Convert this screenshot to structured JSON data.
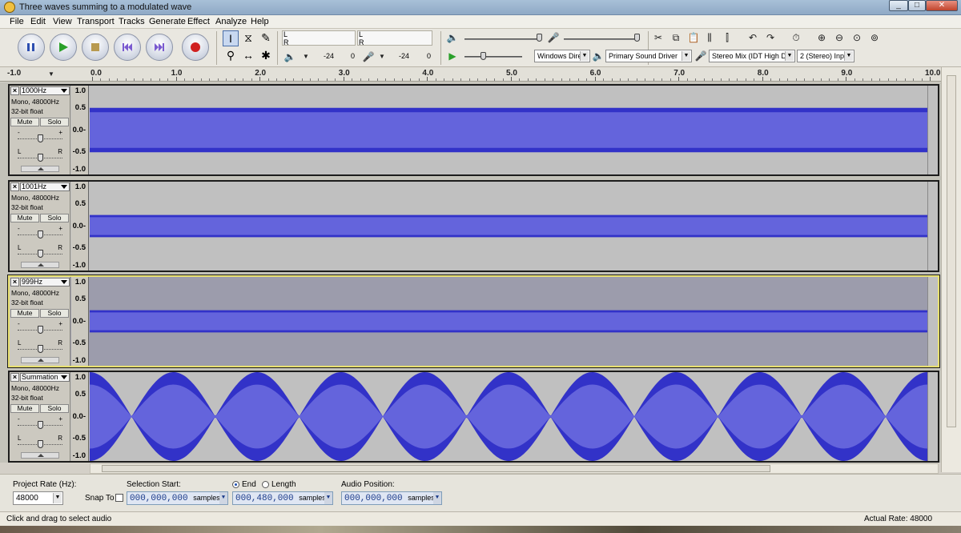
{
  "window": {
    "title": "Three waves summing to a modulated wave",
    "controls": [
      "_",
      "□",
      "✕"
    ]
  },
  "menu": [
    "File",
    "Edit",
    "View",
    "Transport",
    "Tracks",
    "Generate",
    "Effect",
    "Analyze",
    "Help"
  ],
  "toolbar": {
    "meter_lr": [
      "L",
      "R"
    ],
    "play_meter_value": "-24",
    "play_meter_zero": "0",
    "rec_meter_value": "-24",
    "rec_meter_zero": "0",
    "host": "Windows Dire",
    "output_device": "Primary Sound Driver",
    "input_device": "Stereo Mix (IDT High De",
    "channels": "2 (Stereo) Inp"
  },
  "ruler": {
    "start": "-1.0",
    "labels": [
      "0.0",
      "1.0",
      "2.0",
      "3.0",
      "4.0",
      "5.0",
      "6.0",
      "7.0",
      "8.0",
      "9.0",
      "10.0"
    ]
  },
  "vscale": [
    "1.0",
    "0.5",
    "0.0-",
    "-0.5",
    "-1.0"
  ],
  "tracks": [
    {
      "name": "1000Hz",
      "format": "Mono, 48000Hz",
      "bits": "32-bit float",
      "mute": "Mute",
      "solo": "Solo",
      "gain_labels": [
        "-",
        "+"
      ],
      "pan_labels": [
        "L",
        "R"
      ],
      "amplitude": 0.5,
      "selected": false
    },
    {
      "name": "1001Hz",
      "format": "Mono, 48000Hz",
      "bits": "32-bit float",
      "mute": "Mute",
      "solo": "Solo",
      "gain_labels": [
        "-",
        "+"
      ],
      "pan_labels": [
        "L",
        "R"
      ],
      "amplitude": 0.25,
      "selected": false
    },
    {
      "name": "999Hz",
      "format": "Mono, 48000Hz",
      "bits": "32-bit float",
      "mute": "Mute",
      "solo": "Solo",
      "gain_labels": [
        "-",
        "+"
      ],
      "pan_labels": [
        "L",
        "R"
      ],
      "amplitude": 0.25,
      "selected": true
    },
    {
      "name": "Summation",
      "format": "Mono, 48000Hz",
      "bits": "32-bit float",
      "mute": "Mute",
      "solo": "Solo",
      "gain_labels": [
        "-",
        "+"
      ],
      "pan_labels": [
        "L",
        "R"
      ],
      "amplitude": 1.0,
      "selected": false,
      "beat_hz": 1
    }
  ],
  "selection": {
    "project_rate_label": "Project Rate (Hz):",
    "project_rate": "48000",
    "snap_label": "Snap To",
    "selection_start_label": "Selection Start:",
    "end_label": "End",
    "length_label": "Length",
    "start_value": "000,000,000",
    "end_value": "000,480,000",
    "unit": "samples",
    "audio_position_label": "Audio Position:",
    "audio_position_value": "000,000,000"
  },
  "status": {
    "left": "Click and drag to select audio",
    "right": "Actual Rate: 48000"
  },
  "colors": {
    "wave_dark": "#3232c8",
    "wave_light": "#6464dc",
    "track_bg": "#c0c0c0",
    "selected_bg": "#9c9cac"
  }
}
